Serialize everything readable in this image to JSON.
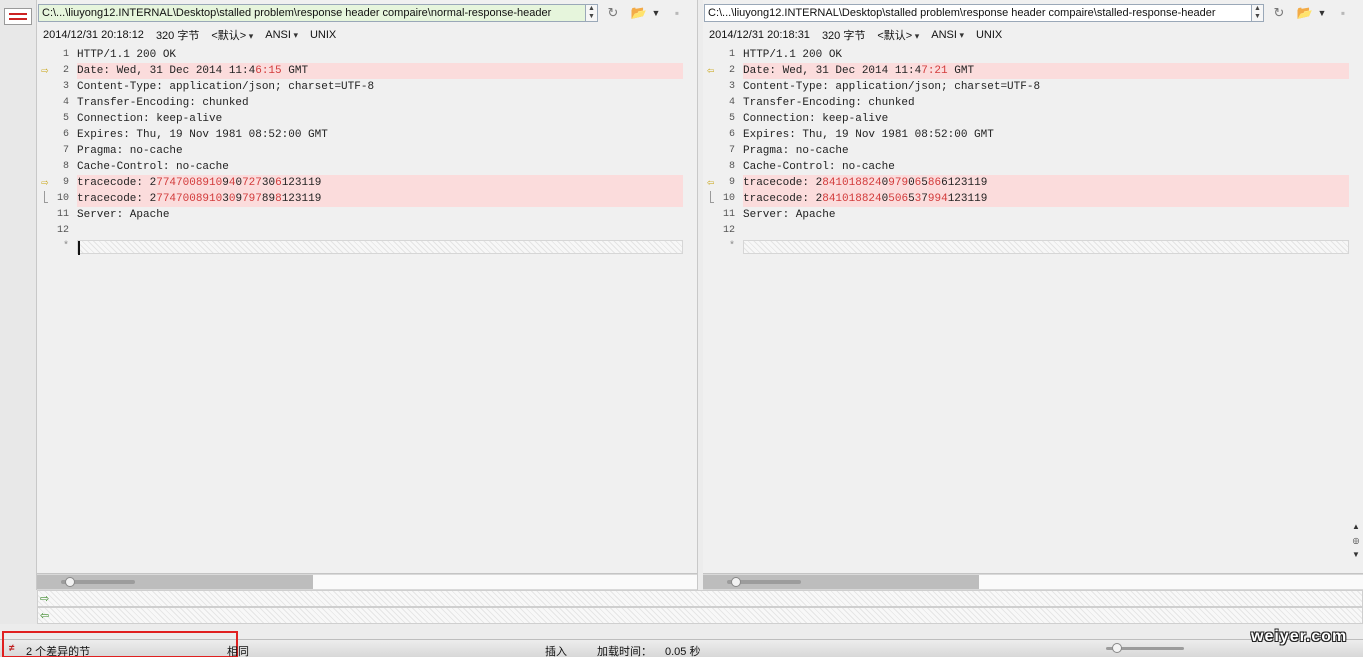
{
  "left": {
    "path": "C:\\...\\liuyong12.INTERNAL\\Desktop\\stalled problem\\response header compaire\\normal-response-header",
    "date": "2014/12/31 20:18:12",
    "size": "320 字节",
    "encoding_default": "<默认>",
    "encoding": "ANSI",
    "line_ending": "UNIX",
    "lines": [
      {
        "n": "1",
        "parts": [
          [
            "HTTP/1.1 200 OK",
            false
          ]
        ]
      },
      {
        "n": "2",
        "diff": true,
        "parts": [
          [
            "Date: Wed, 31 Dec 2014 11:4",
            false
          ],
          [
            "6:15",
            true
          ],
          [
            " GMT",
            false
          ]
        ]
      },
      {
        "n": "3",
        "parts": [
          [
            "Content-Type: application/json; charset=UTF-8",
            false
          ]
        ]
      },
      {
        "n": "4",
        "parts": [
          [
            "Transfer-Encoding: chunked",
            false
          ]
        ]
      },
      {
        "n": "5",
        "parts": [
          [
            "Connection: keep-alive",
            false
          ]
        ]
      },
      {
        "n": "6",
        "parts": [
          [
            "Expires: Thu, 19 Nov 1981 08:52:00 GMT",
            false
          ]
        ]
      },
      {
        "n": "7",
        "parts": [
          [
            "Pragma: no-cache",
            false
          ]
        ]
      },
      {
        "n": "8",
        "parts": [
          [
            "Cache-Control: no-cache",
            false
          ]
        ]
      },
      {
        "n": "9",
        "diff": true,
        "parts": [
          [
            "tracecode: 2",
            false
          ],
          [
            "7747008910",
            true
          ],
          [
            "9",
            false
          ],
          [
            "4",
            true
          ],
          [
            "0",
            false
          ],
          [
            "727",
            true
          ],
          [
            "30",
            false
          ],
          [
            "6",
            true
          ],
          [
            "123119",
            false
          ]
        ]
      },
      {
        "n": "10",
        "diff": true,
        "parts": [
          [
            "tracecode: 2",
            false
          ],
          [
            "7747008910",
            true
          ],
          [
            "3",
            false
          ],
          [
            "0",
            true
          ],
          [
            "9",
            false
          ],
          [
            "797",
            true
          ],
          [
            "89",
            false
          ],
          [
            "8",
            true
          ],
          [
            "123119",
            false
          ]
        ]
      },
      {
        "n": "11",
        "parts": [
          [
            "Server: Apache",
            false
          ]
        ]
      },
      {
        "n": "12",
        "parts": [
          [
            "",
            false
          ]
        ]
      }
    ]
  },
  "right": {
    "path": "C:\\...\\liuyong12.INTERNAL\\Desktop\\stalled problem\\response header compaire\\stalled-response-header",
    "date": "2014/12/31 20:18:31",
    "size": "320 字节",
    "encoding_default": "<默认>",
    "encoding": "ANSI",
    "line_ending": "UNIX",
    "lines": [
      {
        "n": "1",
        "parts": [
          [
            "HTTP/1.1 200 OK",
            false
          ]
        ]
      },
      {
        "n": "2",
        "diff": true,
        "parts": [
          [
            "Date: Wed, 31 Dec 2014 11:4",
            false
          ],
          [
            "7:21",
            true
          ],
          [
            " GMT",
            false
          ]
        ]
      },
      {
        "n": "3",
        "parts": [
          [
            "Content-Type: application/json; charset=UTF-8",
            false
          ]
        ]
      },
      {
        "n": "4",
        "parts": [
          [
            "Transfer-Encoding: chunked",
            false
          ]
        ]
      },
      {
        "n": "5",
        "parts": [
          [
            "Connection: keep-alive",
            false
          ]
        ]
      },
      {
        "n": "6",
        "parts": [
          [
            "Expires: Thu, 19 Nov 1981 08:52:00 GMT",
            false
          ]
        ]
      },
      {
        "n": "7",
        "parts": [
          [
            "Pragma: no-cache",
            false
          ]
        ]
      },
      {
        "n": "8",
        "parts": [
          [
            "Cache-Control: no-cache",
            false
          ]
        ]
      },
      {
        "n": "9",
        "diff": true,
        "parts": [
          [
            "tracecode: 2",
            false
          ],
          [
            "841018824",
            true
          ],
          [
            "0",
            false
          ],
          [
            "979",
            true
          ],
          [
            "0",
            false
          ],
          [
            "6",
            true
          ],
          [
            "5",
            false
          ],
          [
            "86",
            true
          ],
          [
            "6123119",
            false
          ]
        ]
      },
      {
        "n": "10",
        "diff": true,
        "parts": [
          [
            "tracecode: 2",
            false
          ],
          [
            "841018824",
            true
          ],
          [
            "0",
            false
          ],
          [
            "506",
            true
          ],
          [
            "5",
            false
          ],
          [
            "3",
            true
          ],
          [
            "7",
            false
          ],
          [
            "994",
            true
          ],
          [
            "123119",
            false
          ]
        ]
      },
      {
        "n": "11",
        "parts": [
          [
            "Server: Apache",
            false
          ]
        ]
      },
      {
        "n": "12",
        "parts": [
          [
            "",
            false
          ]
        ]
      }
    ]
  },
  "star_line": "*",
  "status": {
    "diff_count": "2 个差异的节",
    "same": "相同",
    "insert_mode": "插入",
    "load_time_label": "加载时间：",
    "load_time": "0.05 秒",
    "watermark": "weiyer.com"
  },
  "colors": {
    "diff_bg": "#fbdcdc",
    "diff_text": "#d23b3b",
    "left_path_bg": "#e6f5dc",
    "status_highlight": "#e02020"
  },
  "icons": [
    "compare-icon",
    "reload-icon",
    "open-folder-icon",
    "dropdown-icon",
    "save-icon",
    "diff-arrow-right-icon",
    "diff-arrow-left-icon",
    "copy-right-icon",
    "copy-left-icon"
  ]
}
